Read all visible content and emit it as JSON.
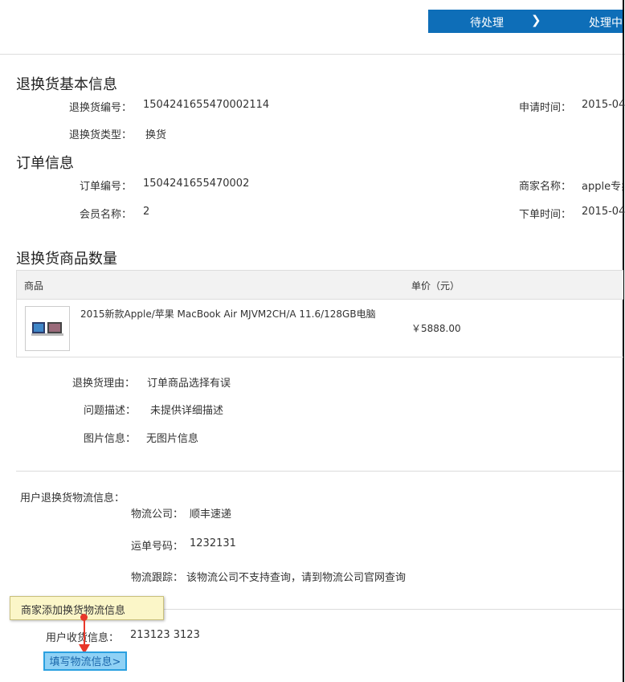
{
  "steps": {
    "pending": "待处理",
    "arrow": "❯",
    "processing": "处理中"
  },
  "basic": {
    "title": "退换货基本信息",
    "no_label": "退换货编号：",
    "no_value": "1504241655470002114",
    "type_label": "退换货类型：",
    "type_value": "换货",
    "apply_time_label": "申请时间：",
    "apply_time_value": "2015-04"
  },
  "order": {
    "title": "订单信息",
    "no_label": "订单编号：",
    "no_value": "1504241655470002",
    "member_label": "会员名称：",
    "member_value": "2",
    "merchant_label": "商家名称：",
    "merchant_value": "apple专卖",
    "order_time_label": "下单时间：",
    "order_time_value": "2015-04"
  },
  "goods": {
    "title": "退换货商品数量",
    "col_product": "商品",
    "col_price": "单价（元）",
    "product_name": "2015新款Apple/苹果 MacBook Air MJVM2CH/A 11.6/128GB电脑",
    "product_price": "￥5888.00",
    "image_icon": "laptop-icon"
  },
  "reason": {
    "reason_label": "退换货理由：",
    "reason_value": "订单商品选择有误",
    "desc_label": "问题描述：",
    "desc_value": "未提供详细描述",
    "image_label": "图片信息：",
    "image_value": "无图片信息"
  },
  "logistics": {
    "title": "用户退换货物流信息：",
    "company_label": "物流公司：",
    "company_value": "顺丰速递",
    "waybill_label": "运单号码：",
    "waybill_value": "1232131",
    "track_label": "物流跟踪：",
    "track_value": "该物流公司不支持查询，请到物流公司官网查询"
  },
  "receive": {
    "label": "用户收货信息：",
    "value": "213123 3123"
  },
  "tooltip": {
    "text": "商家添加换货物流信息"
  },
  "fill_button": {
    "label": "填写物流信息>"
  },
  "colors": {
    "step_bar": "#0e6eb8",
    "annotation": "#e8372a",
    "button_bg": "#8fd1f5"
  }
}
